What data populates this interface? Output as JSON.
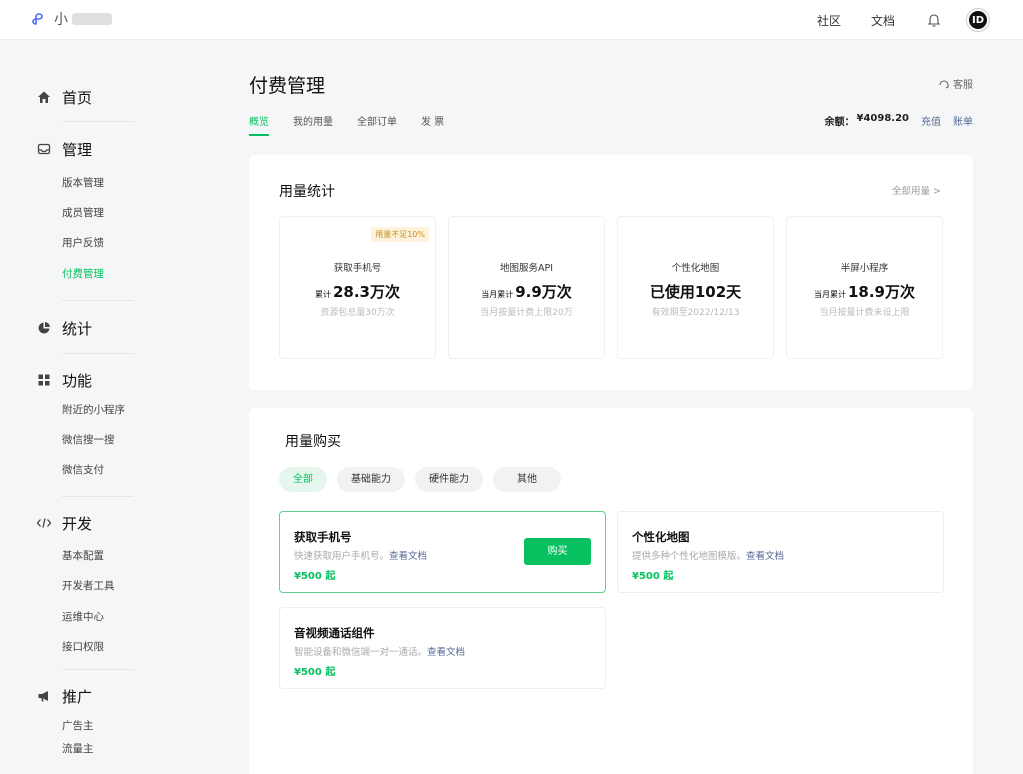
{
  "topbar": {
    "logo_text": "小",
    "links": [
      "社区",
      "文档"
    ],
    "avatar_text": "ID"
  },
  "sidebar": {
    "home": "首页",
    "manage": {
      "label": "管理",
      "items": [
        "版本管理",
        "成员管理",
        "用户反馈",
        "付费管理"
      ]
    },
    "stats": "统计",
    "features": {
      "label": "功能",
      "items": [
        "附近的小程序",
        "微信搜一搜",
        "微信支付"
      ]
    },
    "dev": {
      "label": "开发",
      "items": [
        "基本配置",
        "开发者工具",
        "运维中心",
        "接口权限"
      ]
    },
    "promo": {
      "label": "推广",
      "items": [
        "广告主",
        "流量主"
      ]
    }
  },
  "page": {
    "title": "付费管理",
    "service": "客服",
    "tabs": [
      "概览",
      "我的用量",
      "全部订单",
      "发 票"
    ],
    "balance_label": "余额：",
    "balance_amount": "¥4098.20",
    "recharge": "充值",
    "bill": "账单"
  },
  "usage": {
    "title": "用量统计",
    "more": "全部用量 >",
    "cards": [
      {
        "badge": "用量不足10%",
        "name": "获取手机号",
        "prefix": "累计",
        "value": "28.3万次",
        "sub": "资源包总量30万次"
      },
      {
        "name": "地图服务API",
        "prefix": "当月累计",
        "value": "9.9万次",
        "sub": "当月按量计费上限20万"
      },
      {
        "name": "个性化地图",
        "prefix": "",
        "value": "已使用102天",
        "sub": "有效期至2022/12/13"
      },
      {
        "name": "半屏小程序",
        "prefix": "当月累计",
        "value": "18.9万次",
        "sub": "当月按量计费未设上限"
      }
    ]
  },
  "purchase": {
    "title": "用量购买",
    "chips": [
      "全部",
      "基础能力",
      "硬件能力",
      "其他"
    ],
    "doc_link": "查看文档",
    "buy": "购买",
    "products": [
      {
        "name": "获取手机号",
        "desc": "快速获取用户手机号。",
        "price": "¥500 起"
      },
      {
        "name": "个性化地图",
        "desc": "提供多种个性化地图模版。",
        "price": "¥500 起"
      },
      {
        "name": "音视频通话组件",
        "desc": "智能设备和微信端一对一通话。",
        "price": "¥500 起"
      }
    ]
  }
}
